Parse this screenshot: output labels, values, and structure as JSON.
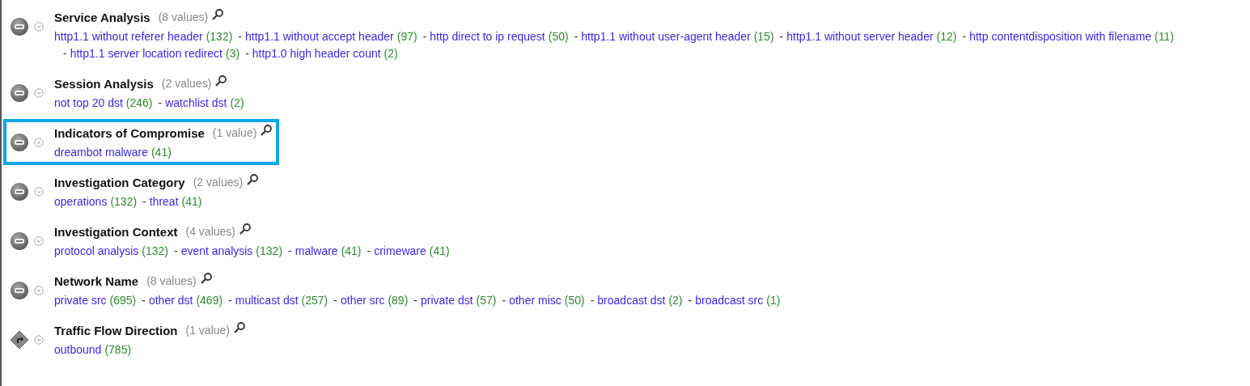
{
  "separator": "-",
  "sections": [
    {
      "title": "Service Analysis",
      "count": "(8 values)",
      "kind": "badge",
      "highlighted": false,
      "lines": [
        [
          {
            "label": "http1.1 without referer header",
            "count": "(132)"
          },
          {
            "label": "http1.1 without accept header",
            "count": "(97)"
          },
          {
            "label": "http direct to ip request",
            "count": "(50)"
          },
          {
            "label": "http1.1 without user-agent header",
            "count": "(15)"
          },
          {
            "label": "http1.1 without server header",
            "count": "(12)"
          },
          {
            "label": "http contentdisposition with filename",
            "count": "(11)"
          }
        ],
        [
          {
            "label": "http1.1 server location redirect",
            "count": "(3)"
          },
          {
            "label": "http1.0 high header count",
            "count": "(2)"
          }
        ]
      ]
    },
    {
      "title": "Session Analysis",
      "count": "(2 values)",
      "kind": "badge",
      "highlighted": false,
      "lines": [
        [
          {
            "label": "not top 20 dst",
            "count": "(246)"
          },
          {
            "label": "watchlist dst",
            "count": "(2)"
          }
        ]
      ]
    },
    {
      "title": "Indicators of Compromise",
      "count": "(1 value)",
      "kind": "badge",
      "highlighted": true,
      "lines": [
        [
          {
            "label": "dreambot malware",
            "count": "(41)"
          }
        ]
      ]
    },
    {
      "title": "Investigation Category",
      "count": "(2 values)",
      "kind": "badge",
      "highlighted": false,
      "lines": [
        [
          {
            "label": "operations",
            "count": "(132)"
          },
          {
            "label": "threat",
            "count": "(41)"
          }
        ]
      ]
    },
    {
      "title": "Investigation Context",
      "count": "(4 values)",
      "kind": "badge",
      "highlighted": false,
      "lines": [
        [
          {
            "label": "protocol analysis",
            "count": "(132)"
          },
          {
            "label": "event analysis",
            "count": "(132)"
          },
          {
            "label": "malware",
            "count": "(41)"
          },
          {
            "label": "crimeware",
            "count": "(41)"
          }
        ]
      ]
    },
    {
      "title": "Network Name",
      "count": "(8 values)",
      "kind": "badge",
      "highlighted": false,
      "lines": [
        [
          {
            "label": "private src",
            "count": "(695)"
          },
          {
            "label": "other dst",
            "count": "(469)"
          },
          {
            "label": "multicast dst",
            "count": "(257)"
          },
          {
            "label": "other src",
            "count": "(89)"
          },
          {
            "label": "private dst",
            "count": "(57)"
          },
          {
            "label": "other misc",
            "count": "(50)"
          },
          {
            "label": "broadcast dst",
            "count": "(2)"
          },
          {
            "label": "broadcast src",
            "count": "(1)"
          }
        ]
      ]
    },
    {
      "title": "Traffic Flow Direction",
      "count": "(1 value)",
      "kind": "direction",
      "highlighted": false,
      "lines": [
        [
          {
            "label": "outbound",
            "count": "(785)"
          }
        ]
      ]
    }
  ]
}
